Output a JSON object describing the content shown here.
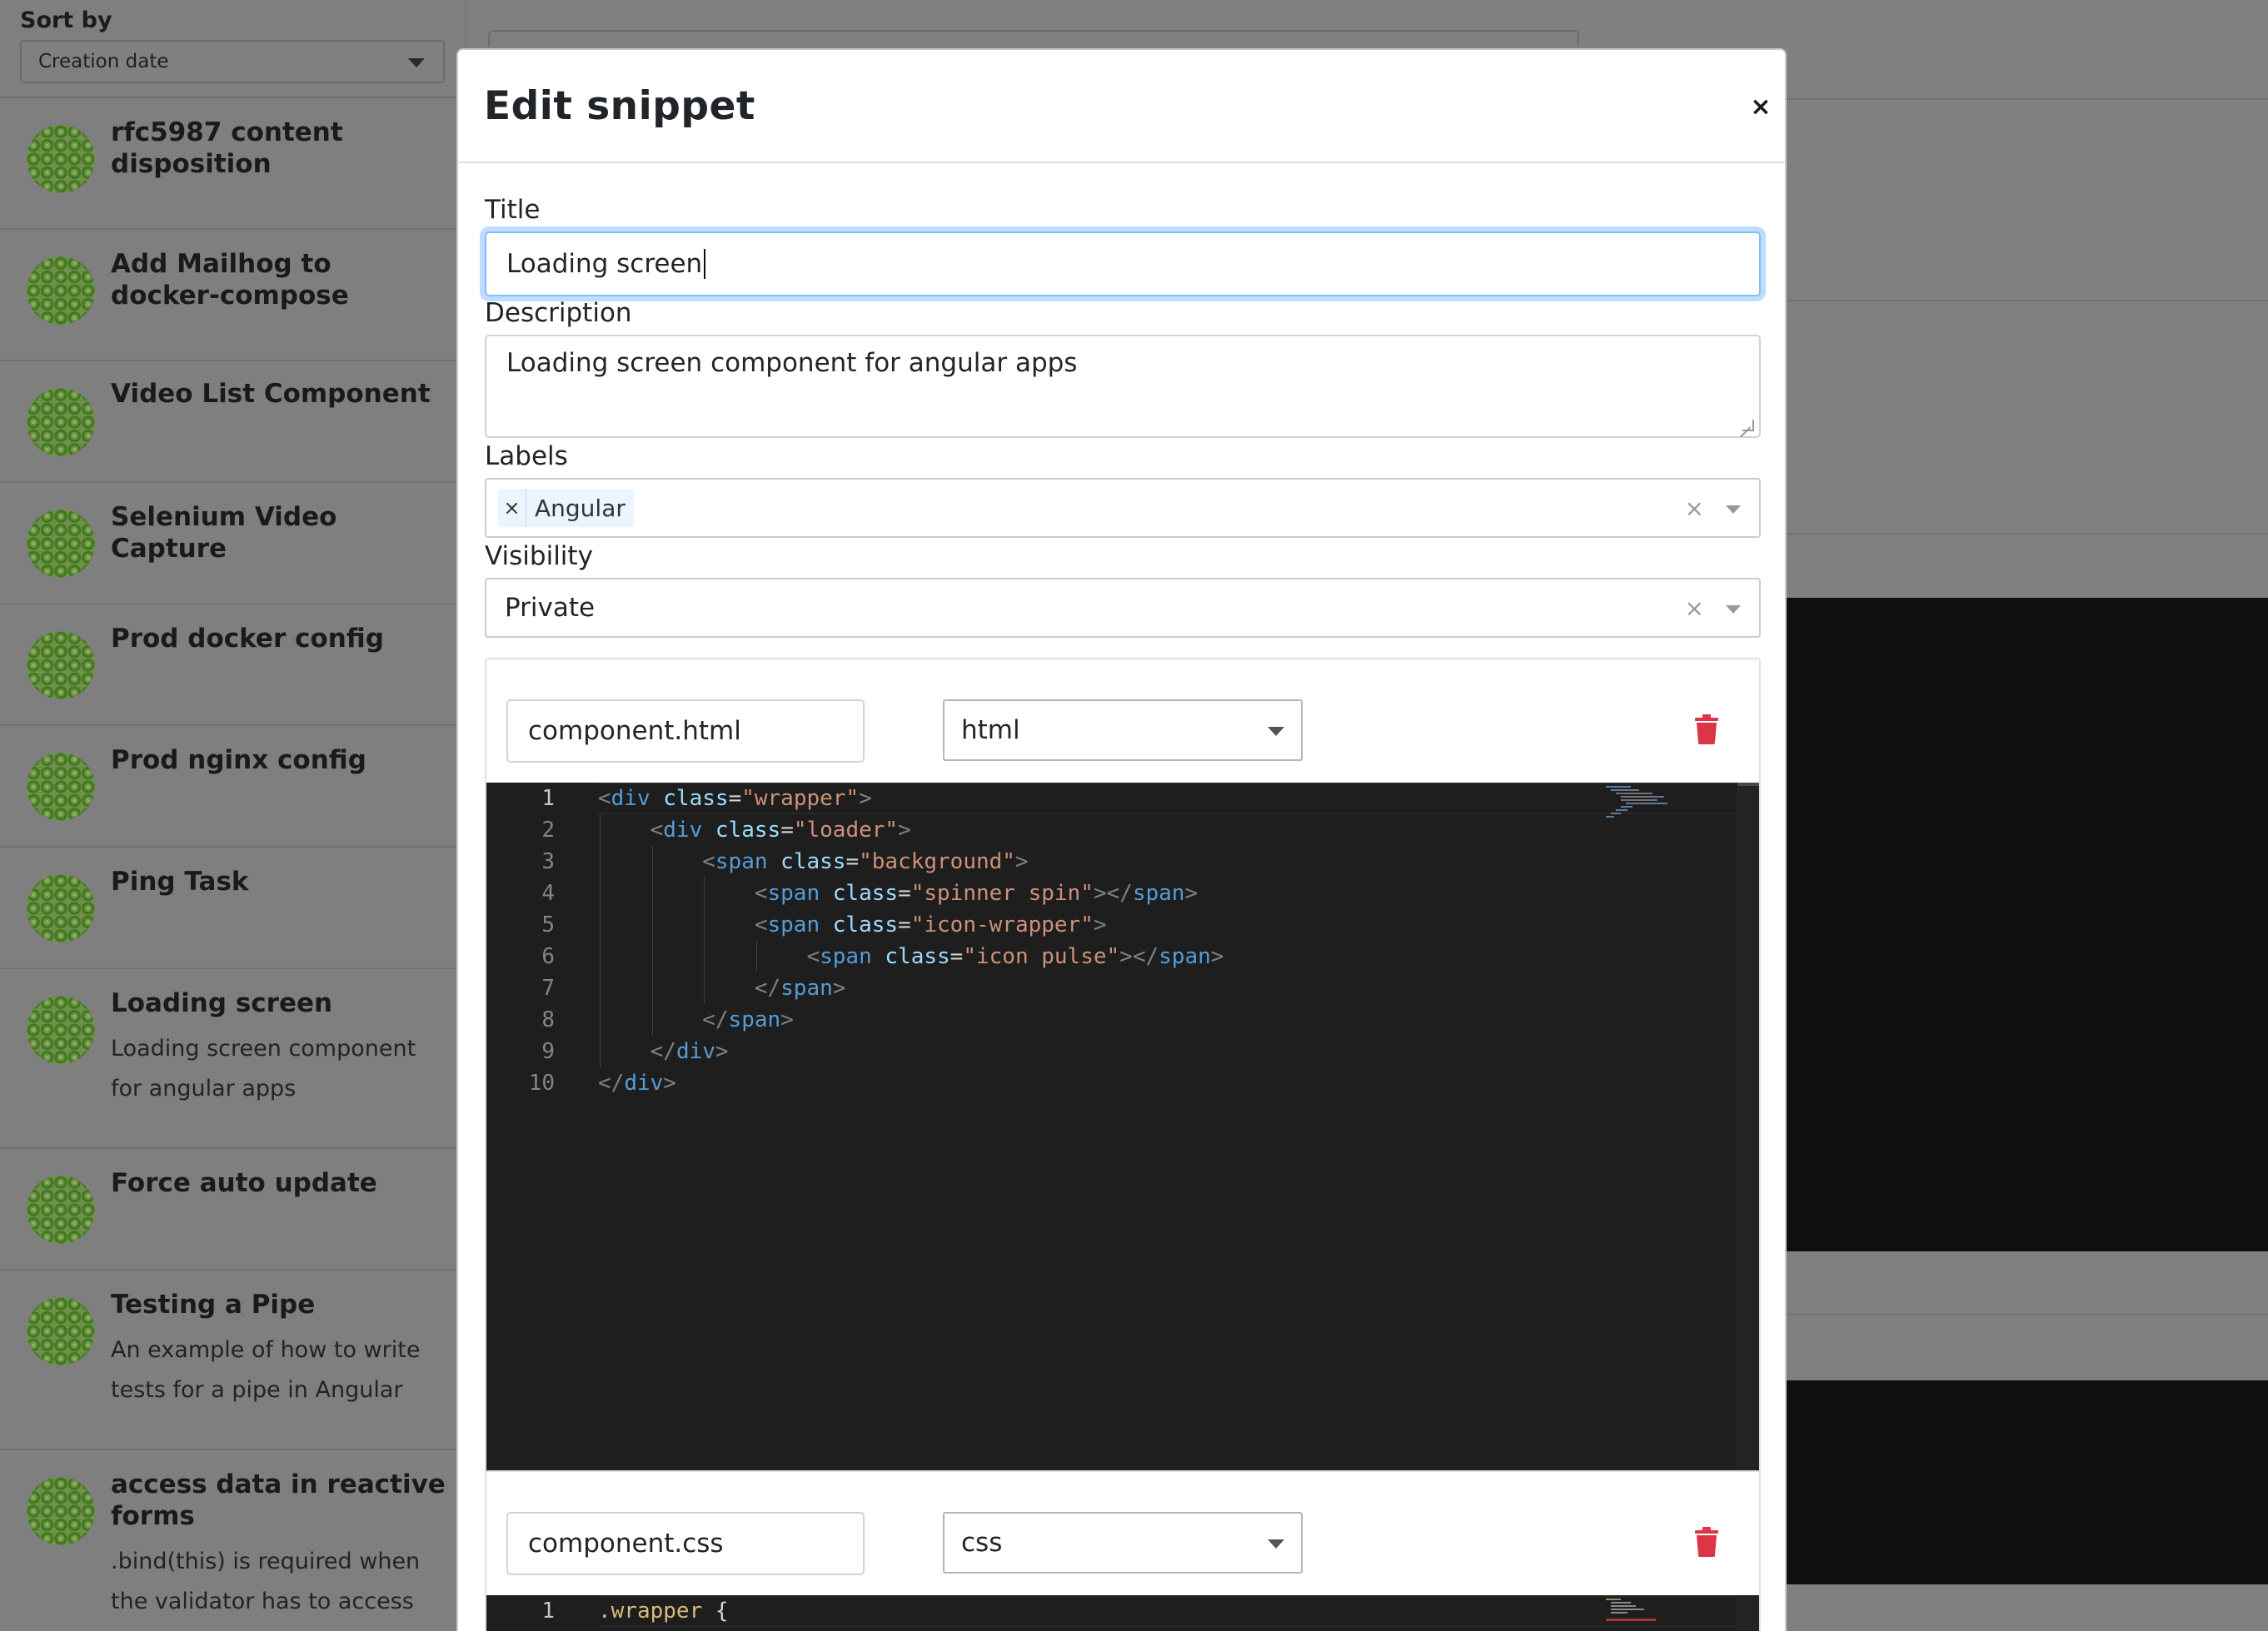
{
  "sidebar": {
    "sort_label": "Sort by",
    "sort_value": "Creation date",
    "snippets": [
      {
        "title": "rfc5987 content disposition",
        "description": ""
      },
      {
        "title": "Add Mailhog to docker-compose",
        "description": ""
      },
      {
        "title": "Video List Component",
        "description": ""
      },
      {
        "title": "Selenium Video Capture",
        "description": ""
      },
      {
        "title": "Prod docker config",
        "description": ""
      },
      {
        "title": "Prod nginx config",
        "description": ""
      },
      {
        "title": "Ping Task",
        "description": ""
      },
      {
        "title": "Loading screen",
        "description": "Loading screen component for angular apps"
      },
      {
        "title": "Force auto update",
        "description": ""
      },
      {
        "title": "Testing a Pipe",
        "description": "An example of how to write tests for a pipe in Angular"
      },
      {
        "title": "access data in reactive forms",
        "description": ".bind(this) is required when the validator has to access"
      }
    ]
  },
  "modal": {
    "title": "Edit snippet",
    "close_label": "×",
    "title_label": "Title",
    "title_value": "Loading screen",
    "description_label": "Description",
    "description_value": "Loading screen component for angular apps",
    "labels_label": "Labels",
    "labels": [
      "Angular"
    ],
    "visibility_label": "Visibility",
    "visibility_value": "Private",
    "clear_glyph": "×",
    "chip_remove_glyph": "×",
    "files": [
      {
        "filename": "component.html",
        "language": "html",
        "line_numbers": [
          "1",
          "2",
          "3",
          "4",
          "5",
          "6",
          "7",
          "8",
          "9",
          "10"
        ]
      },
      {
        "filename": "component.css",
        "language": "css",
        "line_numbers": [
          "1"
        ]
      }
    ]
  },
  "colors": {
    "accent_focus": "#80bdff",
    "delete_red": "#dc3545",
    "editor_bg": "#1e1e1e",
    "avatar_green": "#4b8b2b"
  },
  "icons": {
    "close": "close-icon",
    "trash": "trash-icon",
    "dropdown": "chevron-down-icon",
    "avatar": "identicon-avatar"
  }
}
